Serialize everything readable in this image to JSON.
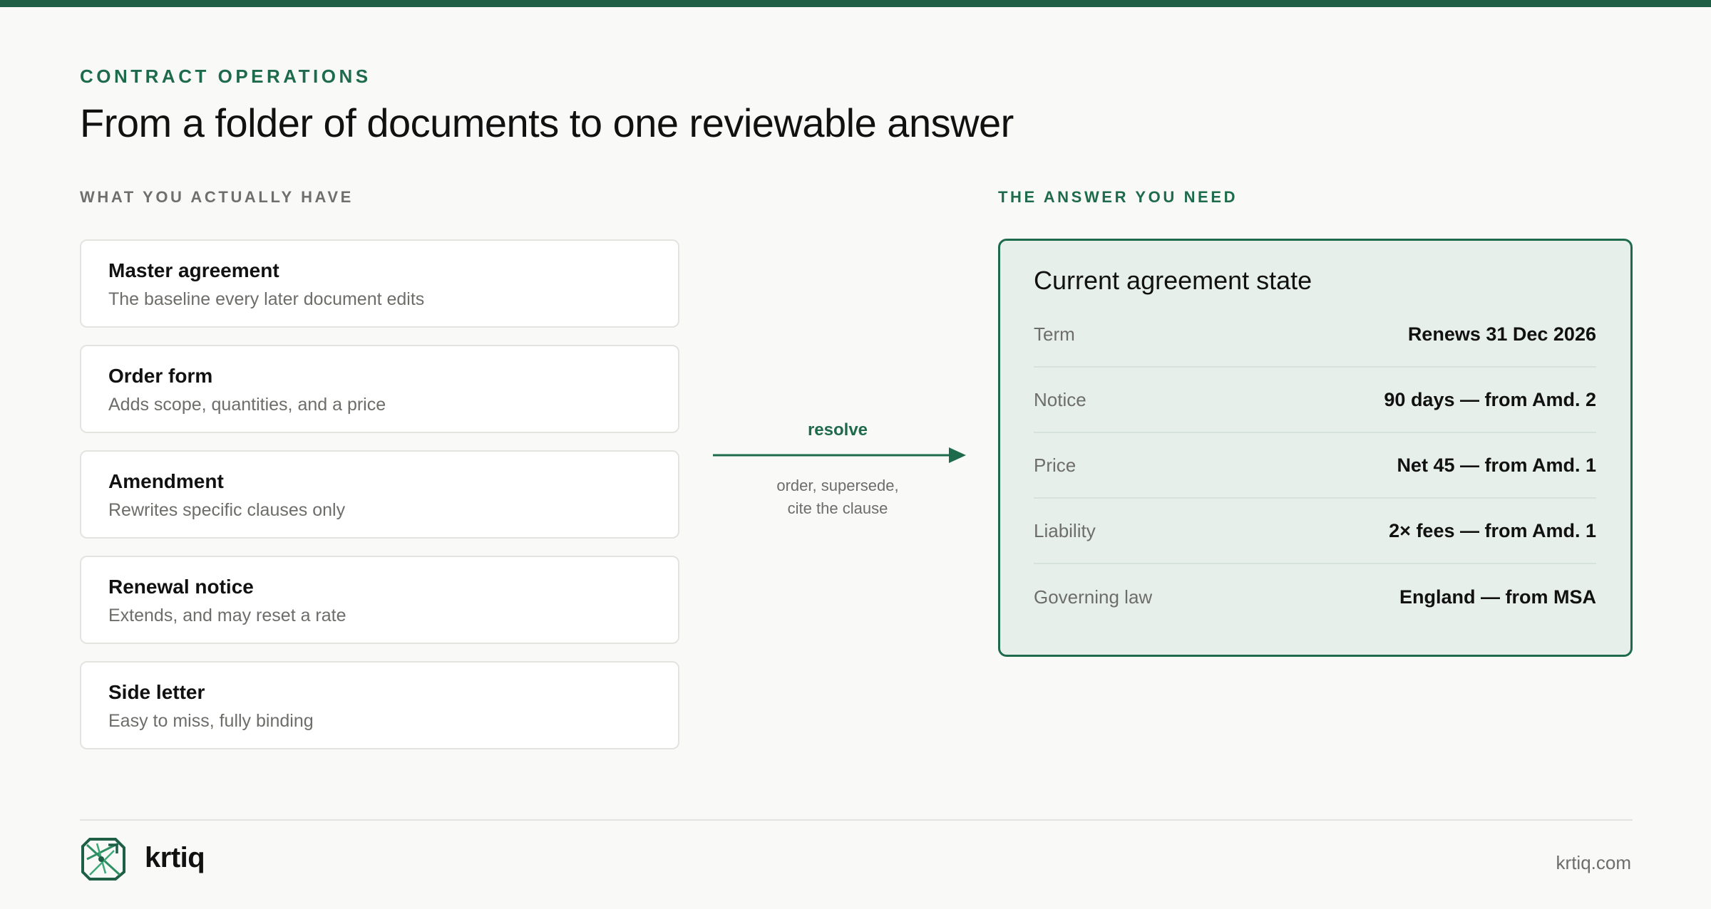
{
  "header": {
    "eyebrow": "CONTRACT OPERATIONS",
    "title": "From a folder of documents to one reviewable answer"
  },
  "left": {
    "section_label": "WHAT YOU ACTUALLY HAVE",
    "documents": [
      {
        "title": "Master agreement",
        "description": "The baseline every later document edits"
      },
      {
        "title": "Order form",
        "description": "Adds scope, quantities, and a price"
      },
      {
        "title": "Amendment",
        "description": "Rewrites specific clauses only"
      },
      {
        "title": "Renewal notice",
        "description": "Extends, and may reset a rate"
      },
      {
        "title": "Side letter",
        "description": "Easy to miss, fully binding"
      }
    ]
  },
  "flow": {
    "label": "resolve",
    "sub_line_1": "order, supersede,",
    "sub_line_2": "cite the clause",
    "icon": "arrow-right-icon"
  },
  "right": {
    "section_label": "THE ANSWER YOU NEED",
    "card_title": "Current agreement state",
    "rows": [
      {
        "label": "Term",
        "value": "Renews 31 Dec 2026"
      },
      {
        "label": "Notice",
        "value": "90 days — from Amd. 2"
      },
      {
        "label": "Price",
        "value": "Net 45 — from Amd. 1"
      },
      {
        "label": "Liability",
        "value": "2× fees — from Amd. 1"
      },
      {
        "label": "Governing law",
        "value": "England — from MSA"
      }
    ]
  },
  "footer": {
    "brand": "krtiq",
    "url": "krtiq.com",
    "logo_icon": "krtiq-logo-icon"
  },
  "colors": {
    "accent": "#1e6b4c",
    "top_bar": "#1e5f45",
    "answer_bg": "#e7efeb",
    "page_bg": "#f9f9f7"
  }
}
